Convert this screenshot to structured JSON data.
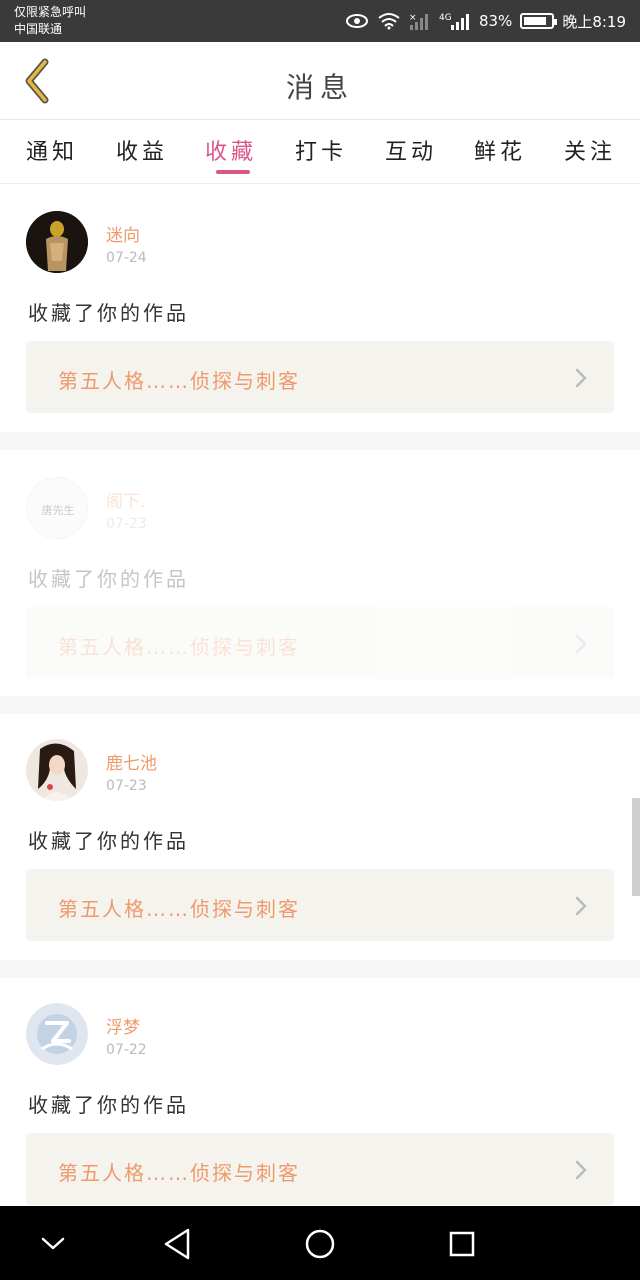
{
  "status_bar": {
    "carrier_line1": "仅限紧急呼叫",
    "carrier_line2": "中国联通",
    "network": "4G",
    "battery_percent": "83%",
    "battery_level": 0.83,
    "time": "晚上8:19",
    "icons": [
      "eye-icon",
      "wifi-icon",
      "signal-icon",
      "signal-4g-icon",
      "battery-icon"
    ]
  },
  "header": {
    "title": "消息",
    "back_icon": "chevron-left-icon"
  },
  "tabs": [
    {
      "label": "通知",
      "active": false
    },
    {
      "label": "收益",
      "active": false
    },
    {
      "label": "收藏",
      "active": true
    },
    {
      "label": "打卡",
      "active": false
    },
    {
      "label": "互动",
      "active": false
    },
    {
      "label": "鲜花",
      "active": false
    },
    {
      "label": "关注",
      "active": false
    }
  ],
  "avatar_text": "唐先生",
  "messages": [
    {
      "user": "迷向",
      "date": "07-24",
      "text": "收藏了你的作品",
      "work": "第五人格……侦探与刺客"
    },
    {
      "user": "阁下.",
      "date": "07-23",
      "text": "收藏了你的作品",
      "work": "第五人格……侦探与刺客"
    },
    {
      "user": "鹿七池",
      "date": "07-23",
      "text": "收藏了你的作品",
      "work": "第五人格……侦探与刺客"
    },
    {
      "user": "浮梦",
      "date": "07-22",
      "text": "收藏了你的作品",
      "work": "第五人格……侦探与刺客"
    }
  ],
  "colors": {
    "accent": "#d9588a",
    "username": "#ef9a6b",
    "card_link_bg": "#f4f3ee",
    "status_bar": "#3a3a3a",
    "back_icon": "#e6b93a"
  },
  "nav_bar": {
    "icons": [
      "chevron-down-icon",
      "back-triangle-icon",
      "home-circle-icon",
      "recent-square-icon"
    ]
  }
}
